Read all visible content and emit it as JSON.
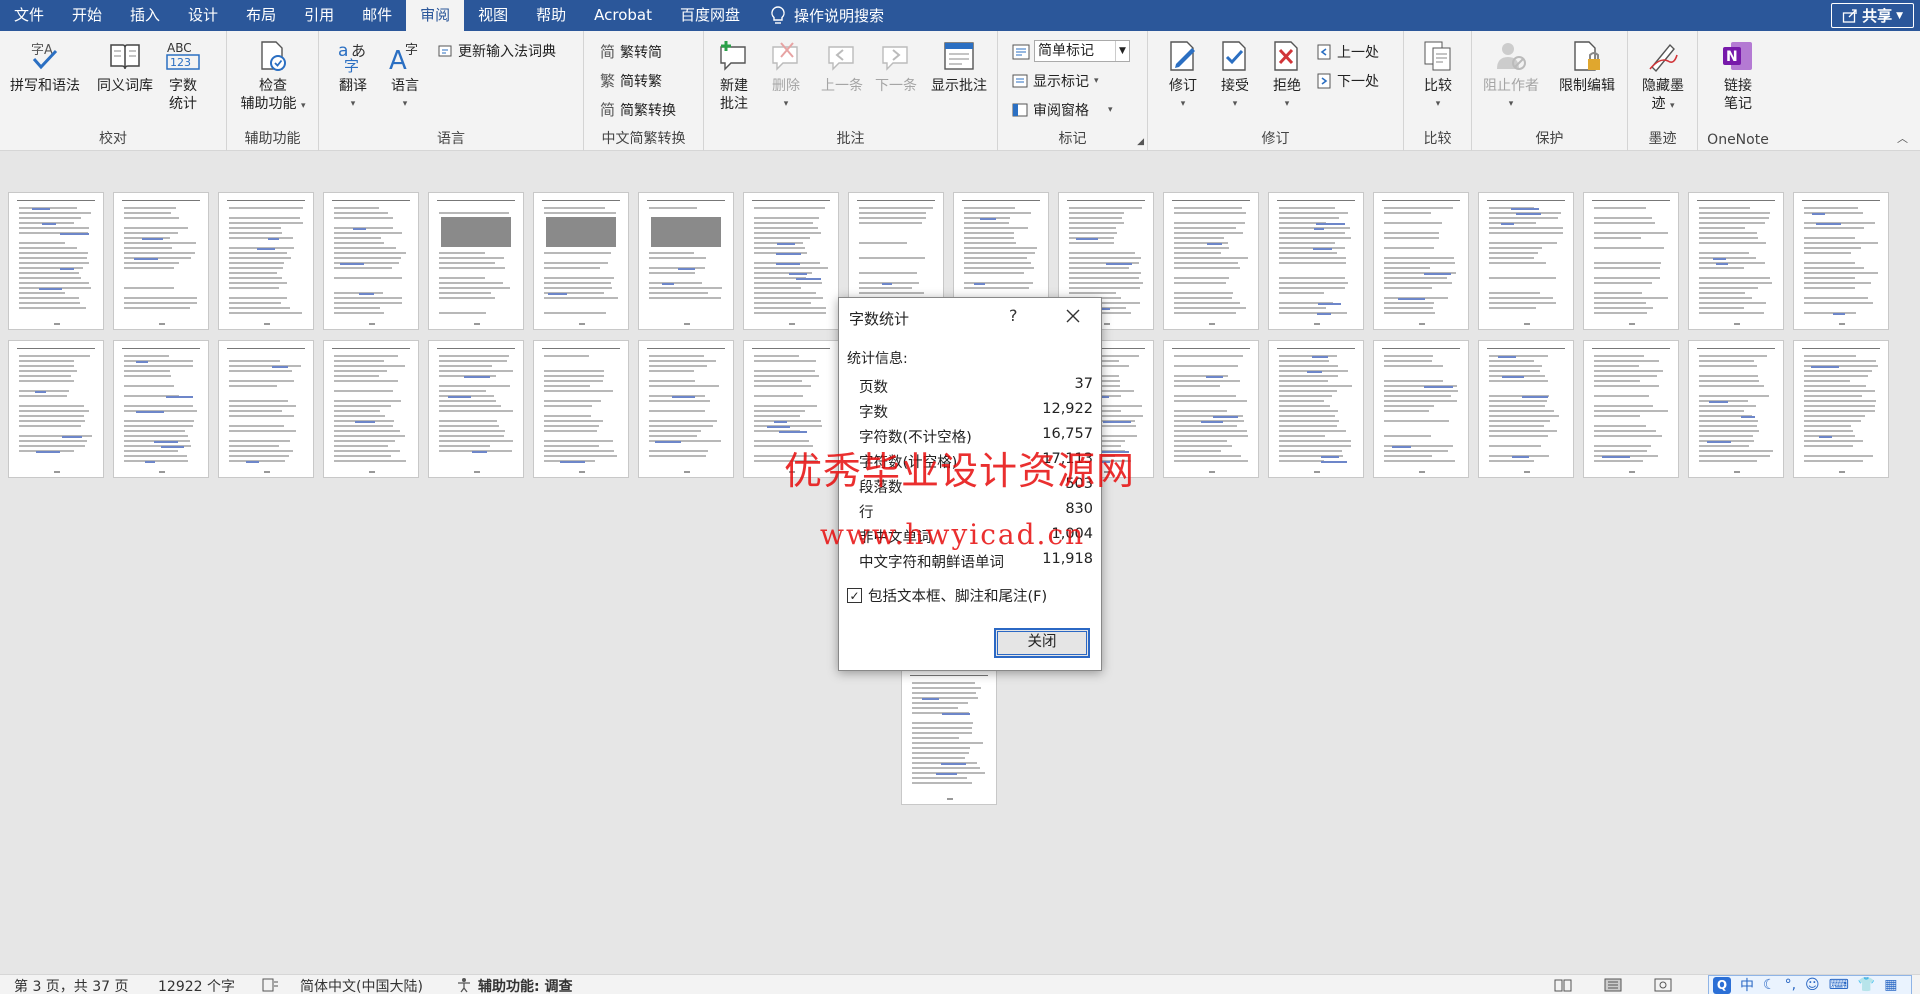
{
  "menubar": {
    "items": [
      "文件",
      "开始",
      "插入",
      "设计",
      "布局",
      "引用",
      "邮件",
      "审阅",
      "视图",
      "帮助",
      "Acrobat",
      "百度网盘"
    ],
    "active": "审阅",
    "tell_me": "操作说明搜索",
    "share": "共享"
  },
  "ribbon": {
    "proofing": {
      "label": "校对",
      "spelling": "拼写和语法",
      "thesaurus": "同义词库",
      "wordcount_l1": "字数",
      "wordcount_l2": "统计",
      "wordcount_icon_text": "ABC\n123"
    },
    "accessibility": {
      "label": "辅助功能",
      "check_l1": "检查",
      "check_l2": "辅助功能"
    },
    "language": {
      "label": "语言",
      "translate": "翻译",
      "language": "语言",
      "update_ime": "更新输入法词典"
    },
    "chinese_conversion": {
      "label": "中文简繁转换",
      "to_simplified": "繁转简",
      "to_traditional": "简转繁",
      "convert": "简繁转换"
    },
    "comments": {
      "label": "批注",
      "new_l1": "新建",
      "new_l2": "批注",
      "delete": "删除",
      "previous": "上一条",
      "next": "下一条",
      "show": "显示批注"
    },
    "tracking": {
      "label": "标记",
      "markup_value": "简单标记",
      "show_markup": "显示标记",
      "reviewing_pane": "审阅窗格"
    },
    "changes": {
      "label": "修订",
      "track": "修订",
      "accept": "接受",
      "reject": "拒绝",
      "previous": "上一处",
      "next": "下一处"
    },
    "compare": {
      "label": "比较",
      "compare": "比较"
    },
    "protect": {
      "label": "保护",
      "block_authors": "阻止作者",
      "restrict": "限制编辑"
    },
    "ink": {
      "label": "墨迹",
      "hide_l1": "隐藏墨",
      "hide_l2": "迹"
    },
    "onenote": {
      "label": "OneNote",
      "link_l1": "链接",
      "link_l2": "笔记"
    }
  },
  "dialog": {
    "title": "字数统计",
    "help": "?",
    "stats_heading": "统计信息:",
    "stats": [
      {
        "label": "页数",
        "value": "37"
      },
      {
        "label": "字数",
        "value": "12,922"
      },
      {
        "label": "字符数(不计空格)",
        "value": "16,757"
      },
      {
        "label": "字符数(计空格)",
        "value": "17,113"
      },
      {
        "label": "段落数",
        "value": "503"
      },
      {
        "label": "行",
        "value": "830"
      },
      {
        "label": "非中文单词",
        "value": "1,004"
      },
      {
        "label": "中文字符和朝鲜语单词",
        "value": "11,918"
      }
    ],
    "include_checkbox": "包括文本框、脚注和尾注(F)",
    "include_checked": true,
    "close_button": "关闭"
  },
  "watermark": {
    "line1": "优秀毕业设计资源网",
    "line2": "www.hwyicad.cn"
  },
  "statusbar": {
    "page": "第 3 页，共 37 页",
    "words": "12922 个字",
    "language": "简体中文(中国大陆)",
    "accessibility": "辅助功能: 调查"
  },
  "ime": {
    "q": "Q",
    "mode": "中"
  },
  "colors": {
    "accent": "#2b579a",
    "watermark": "#e60a0a",
    "dialog_focus": "#2b68c4"
  }
}
